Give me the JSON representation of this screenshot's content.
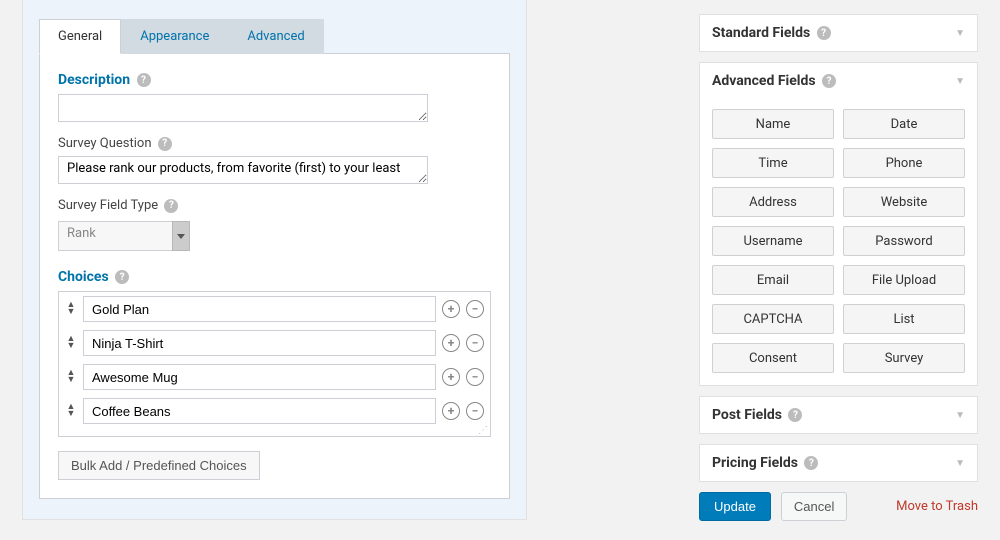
{
  "tabs": {
    "general": "General",
    "appearance": "Appearance",
    "advanced": "Advanced"
  },
  "general": {
    "description_label": "Description",
    "description_value": "",
    "survey_question_label": "Survey Question",
    "survey_question_value": "Please rank our products, from favorite (first) to your least",
    "field_type_label": "Survey Field Type",
    "field_type_value": "Rank",
    "choices_label": "Choices",
    "bulk_add_label": "Bulk Add / Predefined Choices",
    "choices": [
      {
        "value": "Gold Plan"
      },
      {
        "value": "Ninja T-Shirt"
      },
      {
        "value": "Awesome Mug"
      },
      {
        "value": "Coffee Beans"
      }
    ]
  },
  "sidebar": {
    "standard_fields": {
      "title": "Standard Fields"
    },
    "advanced_fields": {
      "title": "Advanced Fields",
      "items": [
        "Name",
        "Date",
        "Time",
        "Phone",
        "Address",
        "Website",
        "Username",
        "Password",
        "Email",
        "File Upload",
        "CAPTCHA",
        "List",
        "Consent",
        "Survey"
      ]
    },
    "post_fields": {
      "title": "Post Fields"
    },
    "pricing_fields": {
      "title": "Pricing Fields"
    }
  },
  "actions": {
    "update": "Update",
    "cancel": "Cancel",
    "trash": "Move to Trash"
  }
}
